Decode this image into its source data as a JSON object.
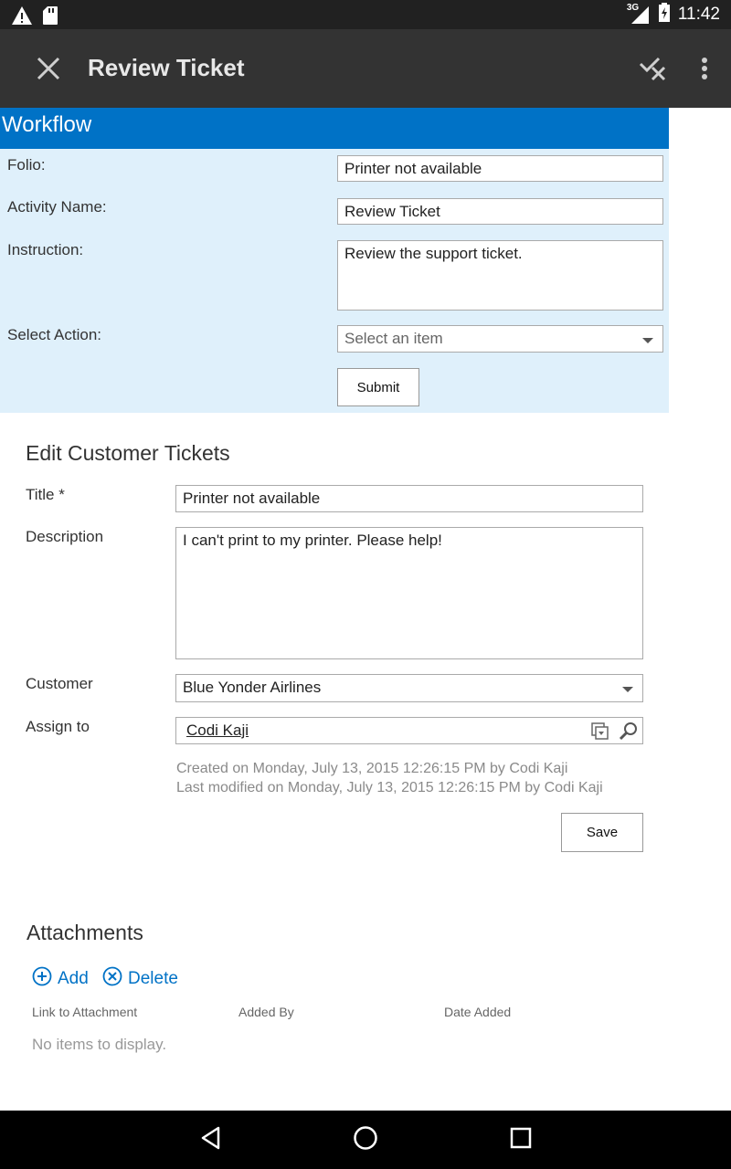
{
  "status_bar": {
    "time": "11:42",
    "network": "3G"
  },
  "app_bar": {
    "title": "Review Ticket"
  },
  "workflow": {
    "header": "Workflow",
    "folio_label": "Folio:",
    "folio_value": "Printer not available",
    "activity_label": "Activity Name:",
    "activity_value": "Review Ticket",
    "instruction_label": "Instruction:",
    "instruction_value": "Review the support ticket.",
    "action_label": "Select Action:",
    "action_placeholder": "Select an item",
    "submit_label": "Submit"
  },
  "edit_form": {
    "title": "Edit Customer Tickets",
    "title_label": "Title *",
    "title_value": "Printer not available",
    "description_label": "Description",
    "description_value": "I can't print to my printer. Please help!",
    "customer_label": "Customer",
    "customer_value": "Blue Yonder Airlines",
    "assign_label": "Assign to",
    "assign_value": "Codi Kaji",
    "created_on": "Created on  Monday, July 13, 2015 12:26:15 PM  by  Codi Kaji",
    "last_modified": "Last modified on  Monday, July 13, 2015 12:26:15 PM  by  Codi Kaji",
    "save_label": "Save"
  },
  "attachments": {
    "title": "Attachments",
    "add_label": "Add",
    "delete_label": "Delete",
    "columns": [
      "Link to Attachment",
      "Added By",
      "Date Added"
    ],
    "empty_message": "No items to display."
  },
  "colors": {
    "accent": "#0072c6",
    "workflow_bg": "#dff0fb",
    "app_bar": "#333333"
  }
}
